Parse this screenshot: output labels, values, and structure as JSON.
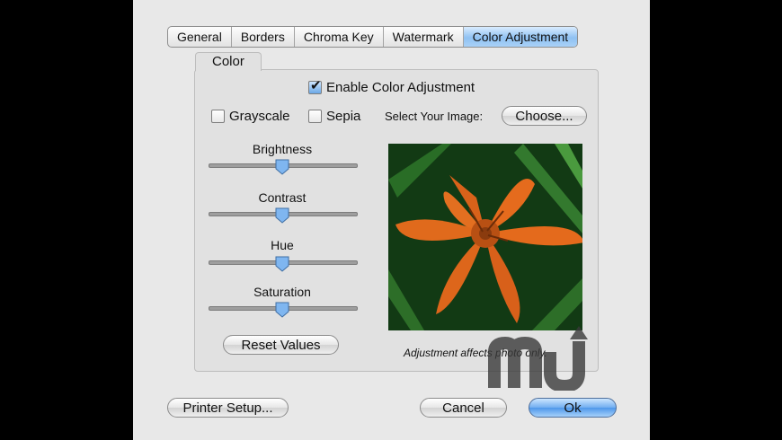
{
  "tabs": [
    "General",
    "Borders",
    "Chroma Key",
    "Watermark",
    "Color Adjustment"
  ],
  "active_tab": "Color Adjustment",
  "group": {
    "title": "Color"
  },
  "enable": {
    "label": "Enable Color Adjustment",
    "checked": true
  },
  "grayscale": {
    "label": "Grayscale",
    "checked": false
  },
  "sepia": {
    "label": "Sepia",
    "checked": false
  },
  "select_image": {
    "label": "Select Your Image:",
    "button": "Choose..."
  },
  "sliders": [
    {
      "label": "Brightness",
      "value": 0.5
    },
    {
      "label": "Contrast",
      "value": 0.5
    },
    {
      "label": "Hue",
      "value": 0.5
    },
    {
      "label": "Saturation",
      "value": 0.5
    }
  ],
  "reset_label": "Reset Values",
  "caption": "Adjustment affects photo only.",
  "footer": {
    "printer": "Printer Setup...",
    "cancel": "Cancel",
    "ok": "Ok"
  },
  "colors": {
    "accent": "#6aa8e6",
    "photo_bg": "#0f2f10",
    "flower": "#e2671c"
  }
}
